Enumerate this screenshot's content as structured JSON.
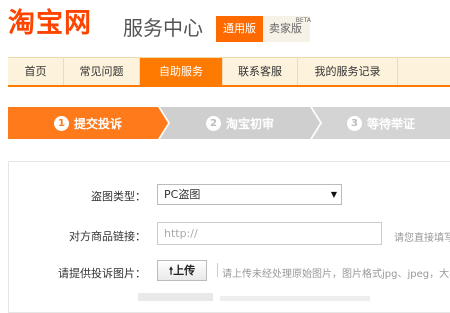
{
  "header": {
    "logo": "淘宝网",
    "title": "服务中心",
    "version_general": "通用版",
    "version_seller": "卖家版",
    "beta": "BETA"
  },
  "nav": {
    "items": [
      "首页",
      "常见问题",
      "自助服务",
      "联系客服",
      "我的服务记录"
    ],
    "active": "自助服务"
  },
  "steps": [
    {
      "num": "1",
      "label": "提交投诉"
    },
    {
      "num": "2",
      "label": "淘宝初审"
    },
    {
      "num": "3",
      "label": "等待举证"
    }
  ],
  "form": {
    "type_label": "盗图类型：",
    "type_value": "PC盗图",
    "link_label": "对方商品链接：",
    "link_placeholder": "http://",
    "link_hint": "请您直接填写",
    "image_label": "请提供投诉图片：",
    "upload_label": "上传",
    "upload_hint": "请上传未经处理原始图片，图片格式jpg、jpeg，大小不"
  },
  "colors": {
    "brand": "#ff4400",
    "accent": "#ff7a00",
    "nav_bg": "#fdf2dc",
    "inactive_step": "#cfcfcf"
  }
}
